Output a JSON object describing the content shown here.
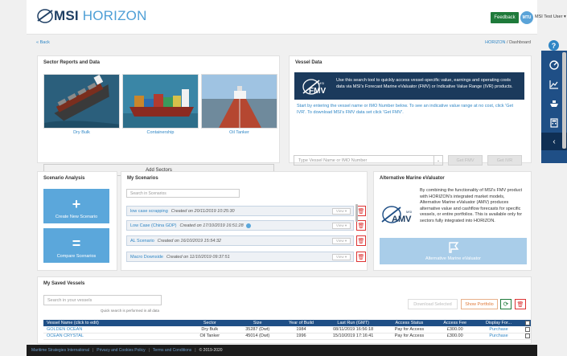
{
  "header": {
    "logo_msi": "MSI",
    "logo_horizon": "HORIZON",
    "feedback": "Feedback",
    "avatar": "MTU",
    "user": "MSI Test User ▾"
  },
  "crumbs": {
    "back": "« Back",
    "root": "HORIZON",
    "sep": "/",
    "current": "Dashboard"
  },
  "sector": {
    "title": "Sector Reports and Data",
    "items": [
      {
        "label": "Dry Bulk"
      },
      {
        "label": "Containership"
      },
      {
        "label": "Oil Tanker"
      }
    ],
    "add": "Add Sectors"
  },
  "vessel_data": {
    "title": "Vessel Data",
    "fmv_logo": "FMV",
    "fmv_msi": "MSI",
    "fmv_text": "Use this search tool to quickly access vessel-specific value, earnings and operating costs data via MSI's Forecast Marine eValuator (FMV) or Indicative Value Range (IVR) products.",
    "instructions": "Start by entering the vessel name or IMO Number below. To see an indicative value range at no cost, click 'Get IVR'. To download MSI's FMV data set click 'Get FMV'.",
    "placeholder": "Type Vessel Name or IMO Number",
    "dd": "⌄",
    "get_fmv": "Get FMV",
    "get_ivr": "Get IVR"
  },
  "scenario": {
    "title": "Scenario Analysis",
    "create": "Create New Scenario",
    "compare": "Compare Scenarios",
    "plus": "+",
    "equals": "="
  },
  "my_scenarios": {
    "title": "My Scenarios",
    "search_placeholder": "Search in Scenarios",
    "view": "View ▾",
    "trash": "🗑",
    "rows": [
      {
        "name": "low case scrapping",
        "date": "Created on 20/11/2019 10:25:30",
        "info": false
      },
      {
        "name": "Low Case (China GDP)",
        "date": "Created on 17/10/2019 16:51:28",
        "info": true
      },
      {
        "name": "AL Scenario",
        "date": "Created on 16/10/2019 15:54:32",
        "info": false
      },
      {
        "name": "Macro Downside",
        "date": "Created on 11/10/2019 09:37:51",
        "info": false
      }
    ]
  },
  "amv": {
    "title": "Alternative Marine eValuator",
    "logo": "AMV",
    "msi": "MSI",
    "text": "By combining the functionality of MSI's FMV product with HORIZON's integrated market models, Alternative Marine eValuator (AMV) produces alternative value and cashflow forecasts for specific vessels, or entire portfolios. This is available only for sectors fully integrated into HORIZON.",
    "button": "Alternative Marine eValuator"
  },
  "saved_vessels": {
    "title": "My Saved Vessels",
    "search_placeholder": "Search in your vessels",
    "hint": "Quick search is performed in all data",
    "download": "Download Selected",
    "portfolio": "Show Portfolio",
    "refresh": "⟳",
    "trash": "🗑",
    "columns": [
      "Vessel Name (click to edit)",
      "Sector",
      "Size",
      "Year of Build",
      "Last Run (GMT)",
      "Access Status",
      "Access Fee",
      "Display For..."
    ],
    "rows": [
      [
        "GOLDEN OCEAN",
        "Dry Bulk",
        "35287 (Dwt)",
        "1984",
        "08/11/2019 16:56:18",
        "Pay for Access",
        "£300.00",
        "Purchase"
      ],
      [
        "OCEAN CRYSTAL",
        "Oil Tanker",
        "45014 (Dwt)",
        "1996",
        "15/10/2019 17:16:41",
        "Pay for Access",
        "£300.00",
        "Purchase"
      ]
    ]
  },
  "footer": {
    "links": [
      "Maritime Strategies International",
      "Privacy and Cookies Policy",
      "Terms and Conditions"
    ],
    "copyright": "© 2019-2020"
  },
  "colors": {
    "navy": "#1f4f86",
    "accent": "#2f86c5",
    "tile": "#5ba7db",
    "feedback": "#1e7a3a"
  }
}
